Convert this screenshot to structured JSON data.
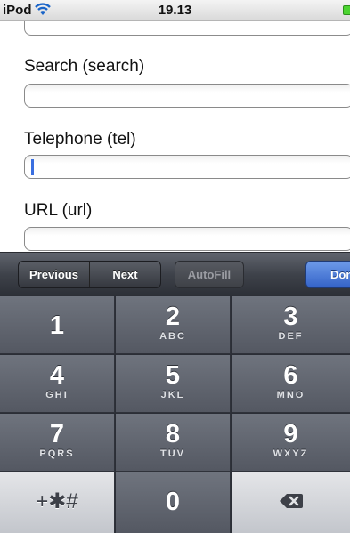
{
  "status_bar": {
    "carrier": "iPod",
    "time": "19.13"
  },
  "form": {
    "fields": [
      {
        "label": "Search (search)",
        "value": ""
      },
      {
        "label": "Telephone (tel)",
        "value": ""
      },
      {
        "label": "URL (url)",
        "value": ""
      }
    ]
  },
  "accessory_bar": {
    "previous_label": "Previous",
    "next_label": "Next",
    "autofill_label": "AutoFill",
    "done_label": "Done"
  },
  "keypad": {
    "keys": [
      {
        "digit": "1",
        "letters": ""
      },
      {
        "digit": "2",
        "letters": "ABC"
      },
      {
        "digit": "3",
        "letters": "DEF"
      },
      {
        "digit": "4",
        "letters": "GHI"
      },
      {
        "digit": "5",
        "letters": "JKL"
      },
      {
        "digit": "6",
        "letters": "MNO"
      },
      {
        "digit": "7",
        "letters": "PQRS"
      },
      {
        "digit": "8",
        "letters": "TUV"
      },
      {
        "digit": "9",
        "letters": "WXYZ"
      },
      {
        "digit": "0",
        "letters": ""
      }
    ],
    "symbols_label": "+✱#",
    "backspace_icon": "backspace-icon"
  },
  "colors": {
    "accent_done": "#3463c8",
    "cursor": "#3a6fe0",
    "battery": "#4cd431"
  }
}
